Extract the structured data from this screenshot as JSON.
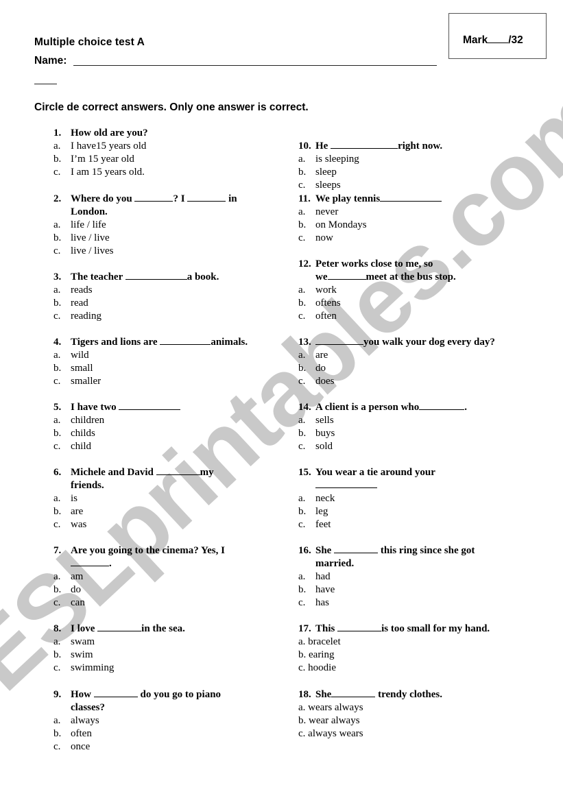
{
  "header": {
    "title": "Multiple choice test A",
    "name_label": "Name:",
    "mark_label": "Mark",
    "mark_total": "/32",
    "instructions": "Circle de correct answers. Only one answer is correct."
  },
  "watermark": "ESLprintables.com",
  "questions": [
    {
      "num": "1.",
      "stem": "How old are you?",
      "options": [
        {
          "letter": "a.",
          "text": "I have15 years old"
        },
        {
          "letter": "b.",
          "text": "I’m 15 year old"
        },
        {
          "letter": "c.",
          "text": "I am 15 years old."
        }
      ]
    },
    {
      "num": "2.",
      "stem_parts": [
        "Where do you ",
        "? I ",
        " in"
      ],
      "stem_line2": "London.",
      "options": [
        {
          "letter": "a.",
          "text": "life / life"
        },
        {
          "letter": "b.",
          "text": "live / live"
        },
        {
          "letter": "c.",
          "text": "live / lives"
        }
      ]
    },
    {
      "num": "3.",
      "stem_parts": [
        "The teacher ",
        "a book."
      ],
      "options": [
        {
          "letter": "a.",
          "text": "reads"
        },
        {
          "letter": "b.",
          "text": "read"
        },
        {
          "letter": "c.",
          "text": "reading"
        }
      ]
    },
    {
      "num": "4.",
      "stem_parts": [
        "Tigers and lions are ",
        "animals."
      ],
      "options": [
        {
          "letter": "a.",
          "text": "wild"
        },
        {
          "letter": "b.",
          "text": "small"
        },
        {
          "letter": "c.",
          "text": "smaller"
        }
      ]
    },
    {
      "num": "5.",
      "stem_parts": [
        "I have two ",
        ""
      ],
      "options": [
        {
          "letter": "a.",
          "text": "children"
        },
        {
          "letter": "b.",
          "text": "childs"
        },
        {
          "letter": "c.",
          "text": "child"
        }
      ]
    },
    {
      "num": "6.",
      "stem_parts": [
        "Michele and David ",
        "my"
      ],
      "stem_line2": "friends.",
      "options": [
        {
          "letter": "a.",
          "text": "is"
        },
        {
          "letter": "b.",
          "text": "are"
        },
        {
          "letter": "c.",
          "text": "was"
        }
      ]
    },
    {
      "num": "7.",
      "stem": "Are you going to the cinema? Yes, I",
      "stem_line2_end": ".",
      "options": [
        {
          "letter": "a.",
          "text": "am"
        },
        {
          "letter": "b.",
          "text": "do"
        },
        {
          "letter": "c.",
          "text": "can"
        }
      ]
    },
    {
      "num": "8.",
      "stem_parts": [
        "I love ",
        "in the sea."
      ],
      "options": [
        {
          "letter": "a.",
          "text": "swam"
        },
        {
          "letter": "b.",
          "text": "swim"
        },
        {
          "letter": "c.",
          "text": "swimming"
        }
      ]
    },
    {
      "num": "9.",
      "stem_parts": [
        "How ",
        " do you go to piano"
      ],
      "stem_line2": "classes?",
      "options": [
        {
          "letter": "a.",
          "text": "always"
        },
        {
          "letter": "b.",
          "text": "often"
        },
        {
          "letter": "c.",
          "text": "once"
        }
      ]
    },
    {
      "num": "10.",
      "stem_parts": [
        "He ",
        "right now."
      ],
      "options": [
        {
          "letter": "a.",
          "text": "is sleeping"
        },
        {
          "letter": "b.",
          "text": "sleep"
        },
        {
          "letter": "c.",
          "text": "sleeps"
        }
      ]
    },
    {
      "num": "11.",
      "stem_parts": [
        "We play tennis",
        ""
      ],
      "options": [
        {
          "letter": "a.",
          "text": "never"
        },
        {
          "letter": "b.",
          "text": "on Mondays"
        },
        {
          "letter": "c.",
          "text": "now"
        }
      ]
    },
    {
      "num": "12.",
      "stem": "Peter works close to me, so",
      "stem_line2_parts": [
        "we",
        "meet at the bus stop."
      ],
      "options": [
        {
          "letter": "a.",
          "text": "work"
        },
        {
          "letter": "b.",
          "text": "oftens"
        },
        {
          "letter": "c.",
          "text": "often"
        }
      ]
    },
    {
      "num": "13.",
      "stem_parts": [
        "",
        "you walk your dog every day?"
      ],
      "options": [
        {
          "letter": "a.",
          "text": "are"
        },
        {
          "letter": "b.",
          "text": "do"
        },
        {
          "letter": "c.",
          "text": "does"
        }
      ]
    },
    {
      "num": "14.",
      "stem_parts": [
        "A client is a person who",
        "."
      ],
      "options": [
        {
          "letter": "a.",
          "text": "sells"
        },
        {
          "letter": "b.",
          "text": "buys"
        },
        {
          "letter": "c.",
          "text": "sold"
        }
      ]
    },
    {
      "num": "15.",
      "stem": "You wear a tie around your",
      "options": [
        {
          "letter": "a.",
          "text": "neck"
        },
        {
          "letter": "b.",
          "text": "leg"
        },
        {
          "letter": "c.",
          "text": "feet"
        }
      ]
    },
    {
      "num": "16.",
      "stem_parts": [
        "She ",
        " this ring since she got"
      ],
      "stem_line2": "married.",
      "options": [
        {
          "letter": "a.",
          "text": "had"
        },
        {
          "letter": "b.",
          "text": "have"
        },
        {
          "letter": "c.",
          "text": "has"
        }
      ]
    },
    {
      "num": "17.",
      "stem_parts": [
        "This ",
        "is too small for my hand."
      ],
      "options": [
        {
          "letter": "a.",
          "text": "bracelet"
        },
        {
          "letter": "b.",
          "text": "earing"
        },
        {
          "letter": "c.",
          "text": "hoodie"
        }
      ]
    },
    {
      "num": "18.",
      "stem_parts": [
        "She",
        " trendy clothes."
      ],
      "options": [
        {
          "letter": "a.",
          "text": "wears always"
        },
        {
          "letter": "b.",
          "text": "wear always"
        },
        {
          "letter": "c.",
          "text": "always wears"
        }
      ]
    }
  ]
}
